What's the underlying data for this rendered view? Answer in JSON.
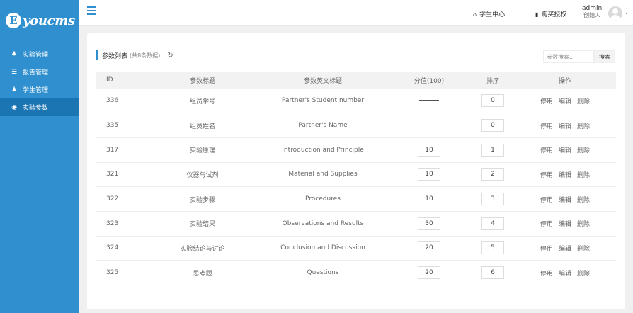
{
  "logo": {
    "letter": "E",
    "text": "youcms"
  },
  "sidebar": {
    "items": [
      {
        "icon": "♣",
        "label": "实验管理",
        "active": false
      },
      {
        "icon": "☰",
        "label": "报告管理",
        "active": false
      },
      {
        "icon": "♟",
        "label": "学生管理",
        "active": false
      },
      {
        "icon": "◉",
        "label": "实验参数",
        "active": true
      }
    ]
  },
  "topbar": {
    "student_center": "学生中心",
    "student_center_icon": "⌂",
    "purchase": "购买授权",
    "purchase_icon": "▮",
    "user_name": "admin",
    "user_role": "创始人",
    "caret": "⌄"
  },
  "panel": {
    "title": "参数列表",
    "count": "(共8条数据)",
    "refresh_icon": "↻",
    "search_placeholder": "参数搜索...",
    "search_button": "搜索"
  },
  "table": {
    "headers": [
      "ID",
      "参数标题",
      "参数英文标题",
      "分值(100)",
      "排序",
      "操作"
    ],
    "actions": [
      "停用",
      "编辑",
      "删除"
    ],
    "rows": [
      {
        "id": "336",
        "title": "组员学号",
        "en_title": "Partner's Student number",
        "score": "",
        "sort": "0"
      },
      {
        "id": "335",
        "title": "组员姓名",
        "en_title": "Partner's Name",
        "score": "",
        "sort": "0"
      },
      {
        "id": "317",
        "title": "实验原理",
        "en_title": "Introduction and Principle",
        "score": "10",
        "sort": "1"
      },
      {
        "id": "321",
        "title": "仪器与试剂",
        "en_title": "Material and Supplies",
        "score": "10",
        "sort": "2"
      },
      {
        "id": "322",
        "title": "实验步骤",
        "en_title": "Procedures",
        "score": "10",
        "sort": "3"
      },
      {
        "id": "323",
        "title": "实验结果",
        "en_title": "Observations and Results",
        "score": "30",
        "sort": "4"
      },
      {
        "id": "324",
        "title": "实验结论与讨论",
        "en_title": "Conclusion and Discussion",
        "score": "20",
        "sort": "5"
      },
      {
        "id": "325",
        "title": "思考题",
        "en_title": "Questions",
        "score": "20",
        "sort": "6"
      }
    ]
  }
}
